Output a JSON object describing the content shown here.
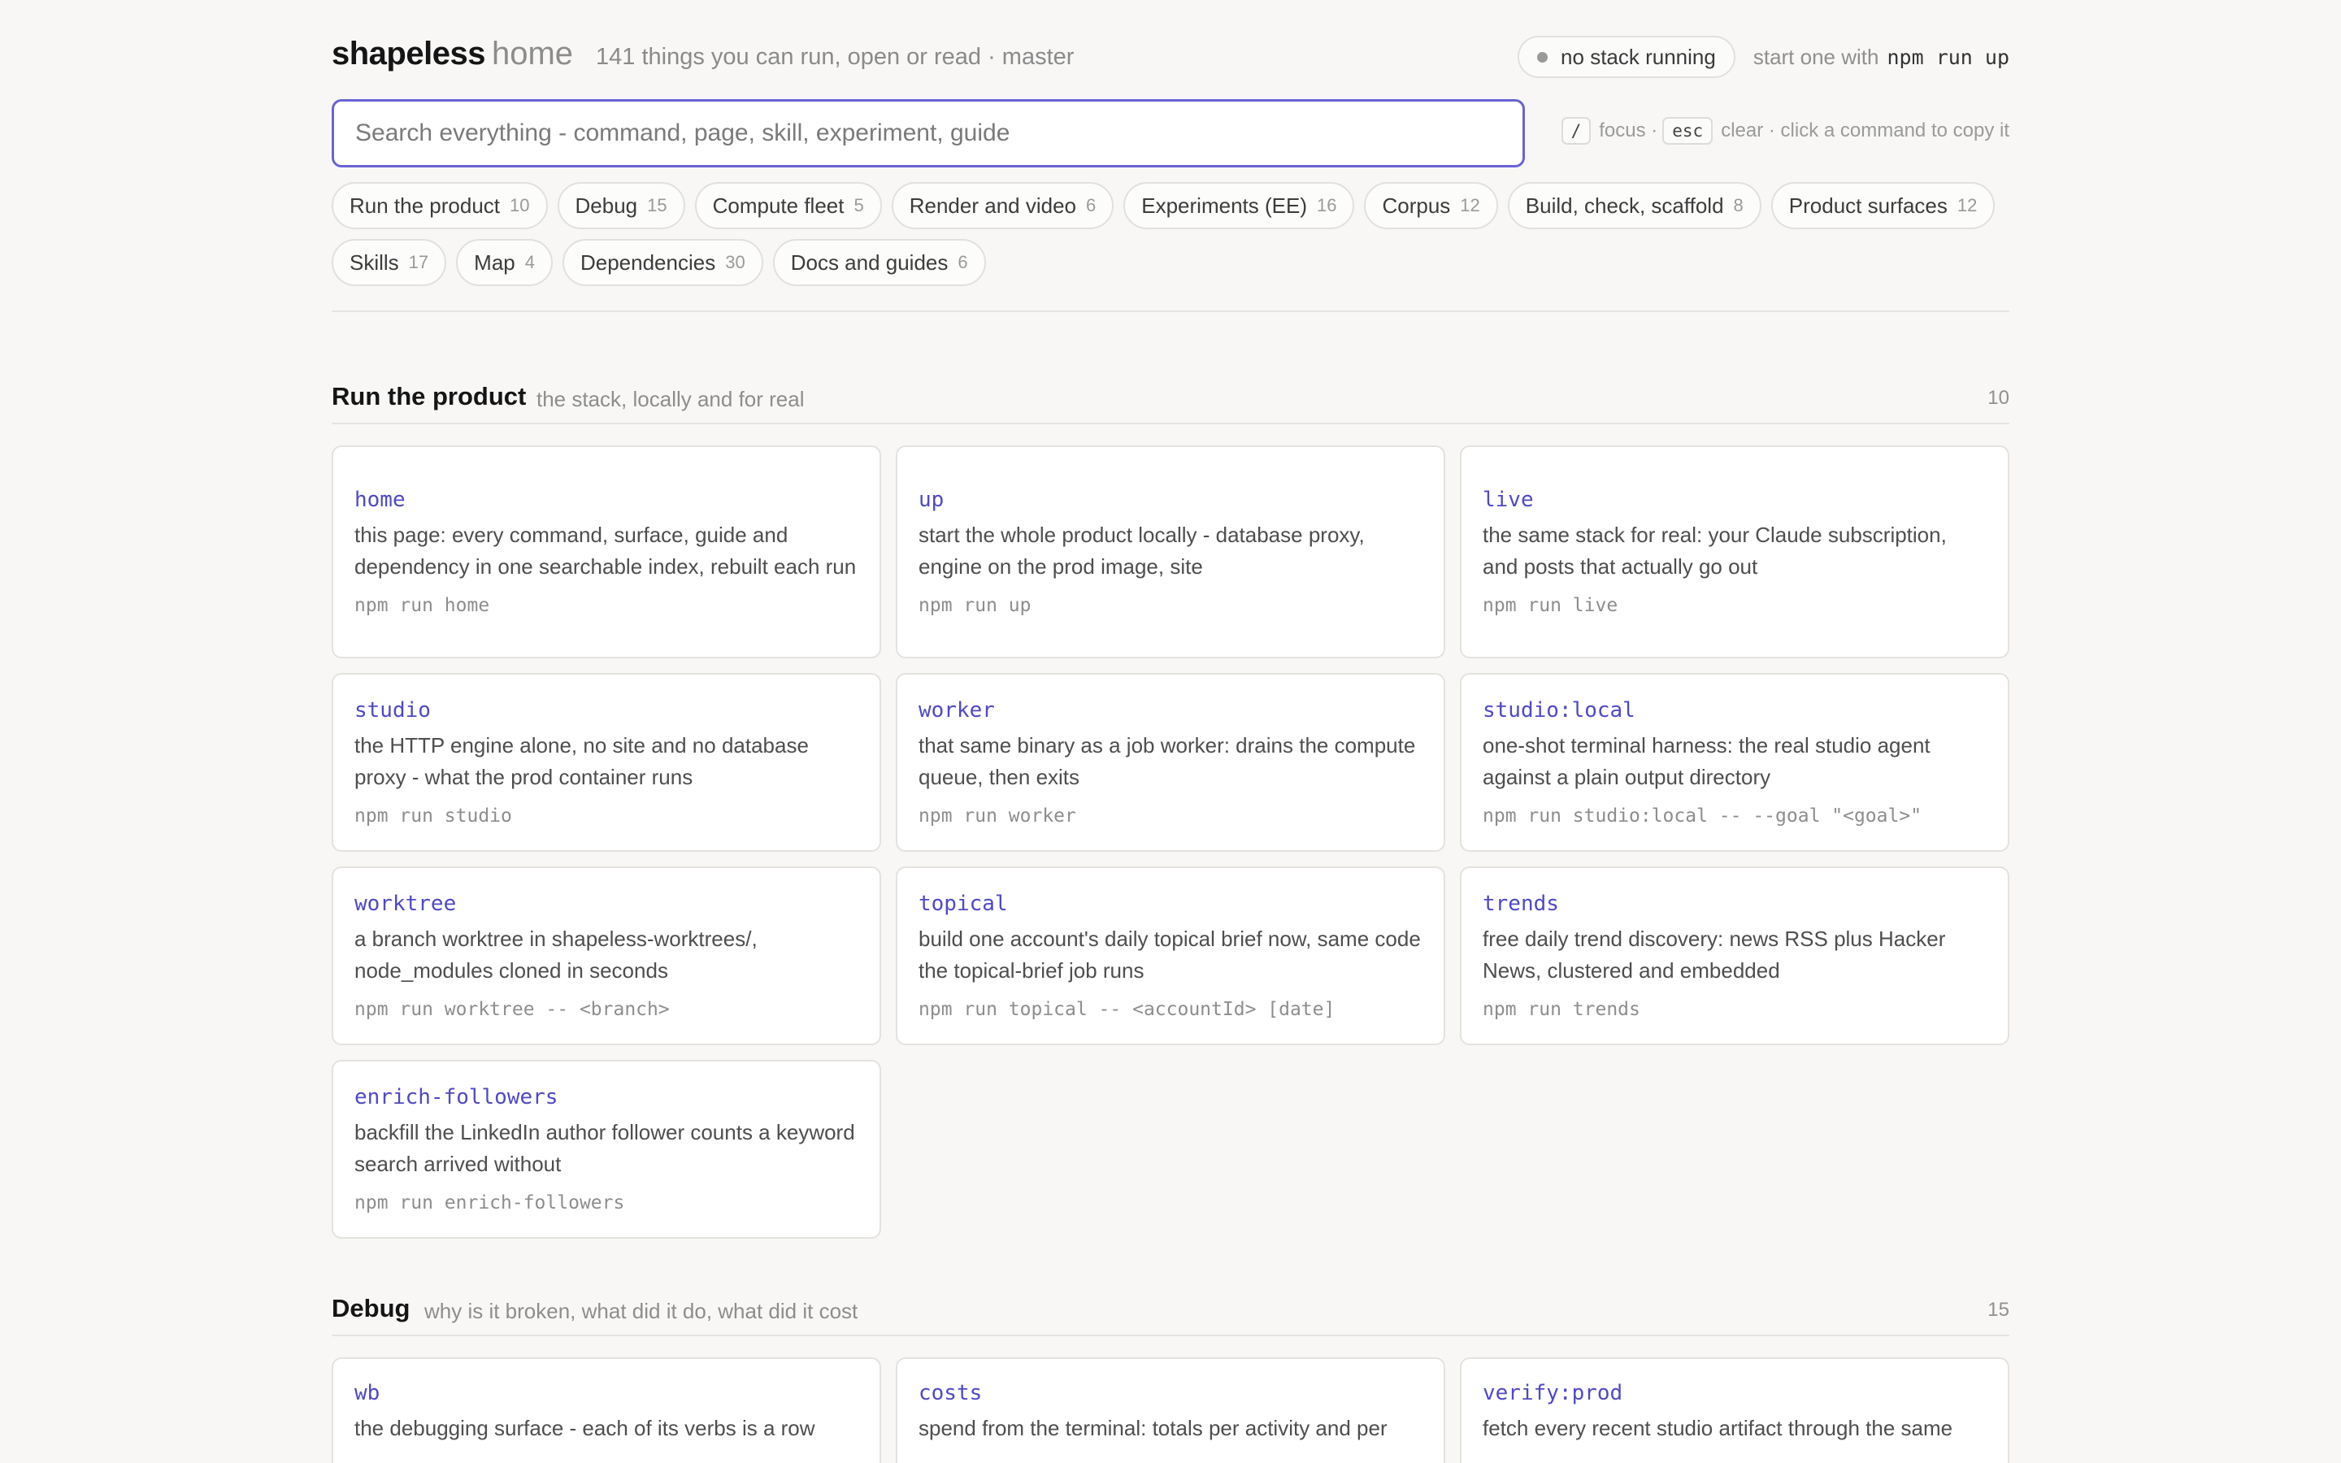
{
  "header": {
    "brand": "shapeless",
    "brand_suffix": "home",
    "subtitle": "141 things you can run, open or read · master",
    "stack_status": "no stack running",
    "start_hint": "start one with",
    "start_command": "npm run up"
  },
  "search": {
    "placeholder": "Search everything - command, page, skill, experiment, guide",
    "value": ""
  },
  "keyboard_hints": {
    "focus_key": "/",
    "focus_label": "focus ·",
    "clear_key": "esc",
    "clear_label": "clear · click a command to copy it"
  },
  "chips": [
    {
      "label": "Run the product",
      "count": "10"
    },
    {
      "label": "Debug",
      "count": "15"
    },
    {
      "label": "Compute fleet",
      "count": "5"
    },
    {
      "label": "Render and video",
      "count": "6"
    },
    {
      "label": "Experiments (EE)",
      "count": "16"
    },
    {
      "label": "Corpus",
      "count": "12"
    },
    {
      "label": "Build, check, scaffold",
      "count": "8"
    },
    {
      "label": "Product surfaces",
      "count": "12"
    },
    {
      "label": "Skills",
      "count": "17"
    },
    {
      "label": "Map",
      "count": "4"
    },
    {
      "label": "Dependencies",
      "count": "30"
    },
    {
      "label": "Docs and guides",
      "count": "6"
    }
  ],
  "sections": [
    {
      "title": "Run the product",
      "description": "the stack, locally and for real",
      "count": "10",
      "cards": [
        {
          "name": "home",
          "description": "this page: every command, surface, guide and dependency in one searchable index, rebuilt each run",
          "command": "npm run home"
        },
        {
          "name": "up",
          "description": "start the whole product locally - database proxy, engine on the prod image, site",
          "command": "npm run up"
        },
        {
          "name": "live",
          "description": "the same stack for real: your Claude subscription, and posts that actually go out",
          "command": "npm run live"
        },
        {
          "name": "studio",
          "description": "the HTTP engine alone, no site and no database proxy - what the prod container runs",
          "command": "npm run studio"
        },
        {
          "name": "worker",
          "description": "that same binary as a job worker: drains the compute queue, then exits",
          "command": "npm run worker"
        },
        {
          "name": "studio:local",
          "description": "one-shot terminal harness: the real studio agent against a plain output directory",
          "command": "npm run studio:local -- --goal \"<goal>\""
        },
        {
          "name": "worktree",
          "description": "a branch worktree in shapeless-worktrees/, node_modules cloned in seconds",
          "command": "npm run worktree -- <branch>"
        },
        {
          "name": "topical",
          "description": "build one account's daily topical brief now, same code the topical-brief job runs",
          "command": "npm run topical -- <accountId> [date]"
        },
        {
          "name": "trends",
          "description": "free daily trend discovery: news RSS plus Hacker News, clustered and embedded",
          "command": "npm run trends"
        },
        {
          "name": "enrich-followers",
          "description": "backfill the LinkedIn author follower counts a keyword search arrived without",
          "command": "npm run enrich-followers"
        }
      ]
    },
    {
      "title": "Debug",
      "description": "why is it broken, what did it do, what did it cost",
      "count": "15",
      "cards": [
        {
          "name": "wb",
          "description": "the debugging surface - each of its verbs is a row",
          "command": ""
        },
        {
          "name": "costs",
          "description": "spend from the terminal: totals per activity and per",
          "command": ""
        },
        {
          "name": "verify:prod",
          "description": "fetch every recent studio artifact through the same",
          "command": ""
        }
      ]
    }
  ]
}
